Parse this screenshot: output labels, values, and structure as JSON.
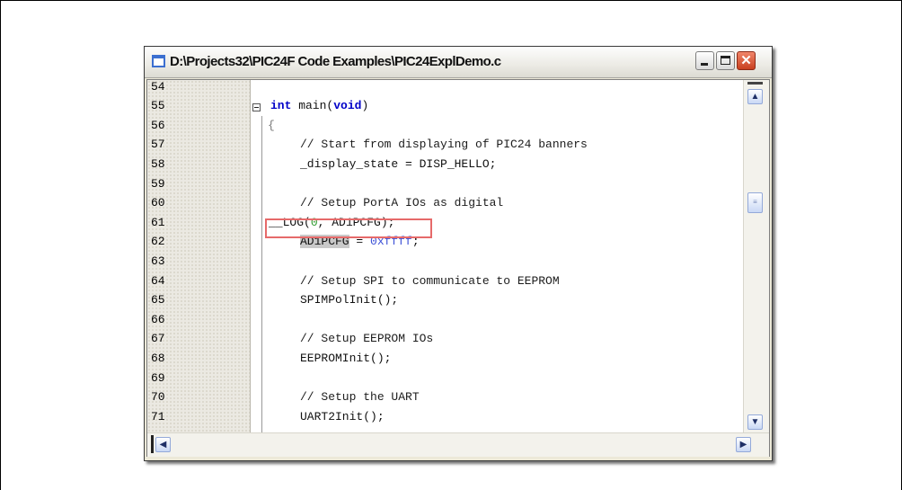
{
  "window": {
    "title": "D:\\Projects32\\PIC24F Code Examples\\PIC24ExplDemo.c",
    "controls": {
      "minimize": "minimize",
      "maximize": "maximize",
      "close": "close"
    }
  },
  "editor": {
    "line_numbers": [
      "54",
      "55",
      "56",
      "57",
      "58",
      "59",
      "60",
      "61",
      "62",
      "63",
      "64",
      "65",
      "66",
      "67",
      "68",
      "69",
      "70",
      "71"
    ],
    "code": {
      "l55_kw": "int",
      "l55_mid": " main(",
      "l55_arg": "void",
      "l55_end": ")",
      "l56": "{",
      "l57": "// Start from displaying of PIC24 banners",
      "l58": "_display_state = DISP_HELLO;",
      "l60": "// Setup PortA IOs as digital",
      "l61_a": "__LOG(",
      "l61_b": "0",
      "l61_c": ", AD1PCFG);",
      "l62_a": "AD1PCFG",
      "l62_b": " = ",
      "l62_c": "0xffff",
      "l62_d": ";",
      "l64": "// Setup SPI to communicate to EEPROM",
      "l65": "SPIMPolInit();",
      "l67": "// Setup EEPROM IOs",
      "l68": "EEPROMInit();",
      "l70": "// Setup the UART",
      "l71": "UART2Init();"
    }
  },
  "scroll": {
    "vertical_position": 0.33,
    "icons": {
      "up": "▲",
      "down": "▼",
      "left": "◀",
      "right": "▶",
      "thumb": "≡"
    }
  }
}
